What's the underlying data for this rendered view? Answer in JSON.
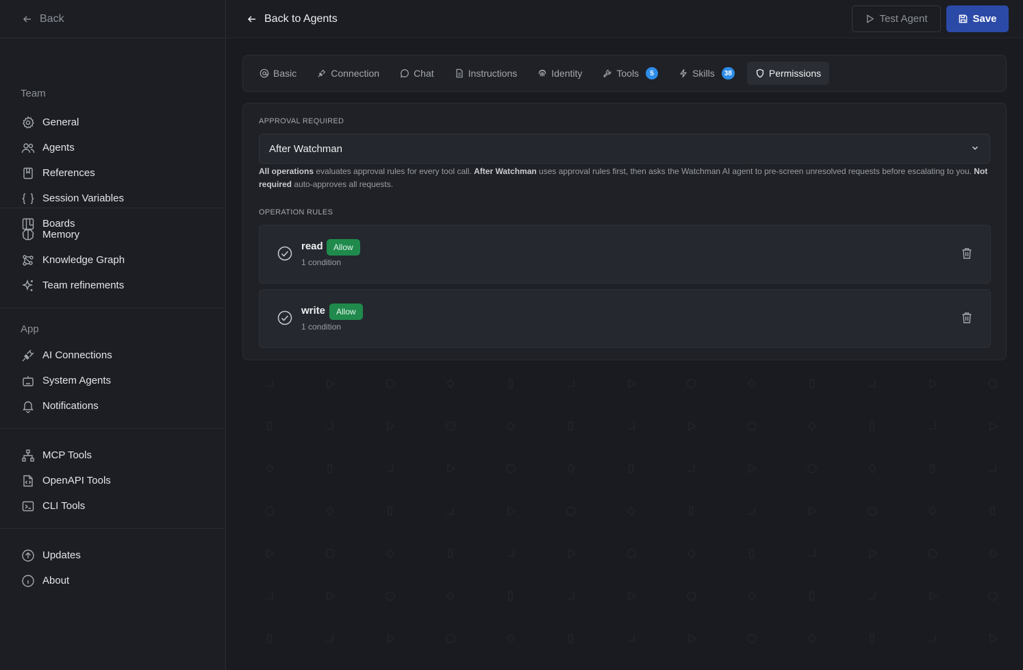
{
  "sidebar": {
    "back_label": "Back",
    "sections": [
      {
        "heading": "Team",
        "items": [
          {
            "label": "General",
            "icon": "gear-icon"
          },
          {
            "label": "Agents",
            "icon": "users-icon"
          },
          {
            "label": "References",
            "icon": "bookmark-icon"
          },
          {
            "label": "Session Variables",
            "icon": "braces-icon"
          },
          {
            "label": "Boards",
            "icon": "board-icon"
          }
        ]
      },
      {
        "heading": "",
        "items": [
          {
            "label": "Memory",
            "icon": "brain-icon"
          },
          {
            "label": "Knowledge Graph",
            "icon": "graph-icon"
          },
          {
            "label": "Team refinements",
            "icon": "sparkle-icon"
          }
        ]
      },
      {
        "heading": "App",
        "items": [
          {
            "label": "AI Connections",
            "icon": "plug-icon"
          },
          {
            "label": "System Agents",
            "icon": "bot-icon"
          },
          {
            "label": "Notifications",
            "icon": "bell-icon"
          }
        ]
      },
      {
        "heading": "",
        "items": [
          {
            "label": "MCP Tools",
            "icon": "network-icon"
          },
          {
            "label": "OpenAPI Tools",
            "icon": "file-code-icon"
          },
          {
            "label": "CLI Tools",
            "icon": "terminal-icon"
          }
        ]
      },
      {
        "heading": "",
        "items": [
          {
            "label": "Updates",
            "icon": "arrow-up-circle-icon"
          },
          {
            "label": "About",
            "icon": "info-icon"
          }
        ]
      }
    ]
  },
  "header": {
    "back_label": "Back to Agents",
    "test_label": "Test Agent",
    "save_label": "Save"
  },
  "tabs": [
    {
      "label": "Basic",
      "icon": "at-icon"
    },
    {
      "label": "Connection",
      "icon": "plug-icon"
    },
    {
      "label": "Chat",
      "icon": "chat-icon"
    },
    {
      "label": "Instructions",
      "icon": "file-icon"
    },
    {
      "label": "Identity",
      "icon": "fingerprint-icon"
    },
    {
      "label": "Tools",
      "icon": "wrench-icon",
      "badge": "5"
    },
    {
      "label": "Skills",
      "icon": "bolt-icon",
      "badge": "38"
    },
    {
      "label": "Permissions",
      "icon": "shield-icon",
      "active": true
    }
  ],
  "permissions": {
    "approval_heading": "APPROVAL REQUIRED",
    "approval_value": "After Watchman",
    "help": {
      "b1": "All operations",
      "t1": " evaluates approval rules for every tool call. ",
      "b2": "After Watchman",
      "t2": " uses approval rules first, then asks the Watchman AI agent to pre-screen unresolved requests before escalating to you. ",
      "b3": "Not required",
      "t3": " auto-approves all requests."
    },
    "rules_heading": "OPERATION RULES",
    "rules": [
      {
        "name": "read",
        "badge": "Allow",
        "condition": "1 condition"
      },
      {
        "name": "write",
        "badge": "Allow",
        "condition": "1 condition"
      }
    ]
  },
  "colors": {
    "accent": "#2b4aa8",
    "badge": "#2e8de8",
    "allow": "#1f8a4c"
  }
}
